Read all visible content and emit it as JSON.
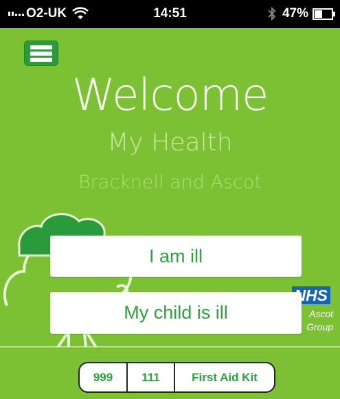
{
  "status_bar": {
    "carrier": "O2-UK",
    "time": "14:51",
    "battery_percent": "47%",
    "battery_level": 0.47,
    "icons": [
      "signal-icon",
      "wifi-icon",
      "bluetooth-icon",
      "battery-icon"
    ]
  },
  "menu": {
    "icon": "hamburger-menu-icon"
  },
  "header": {
    "welcome": "Welcome",
    "subtitle": "My Health",
    "area": "Bracknell and Ascot"
  },
  "logo": {
    "nhs": "NHS",
    "line1": "Ascot",
    "line2": "Group"
  },
  "actions": {
    "ill_label": "I am ill",
    "child_label": "My child is ill"
  },
  "bottom_nav": {
    "emergency_label": "999",
    "nonemergency_label": "111",
    "first_aid_label": "First Aid Kit"
  },
  "colors": {
    "background": "#7cc133",
    "accent_green": "#2aa33a",
    "menu_button": "#2a9b3a",
    "nhs_blue": "#1465b6"
  }
}
